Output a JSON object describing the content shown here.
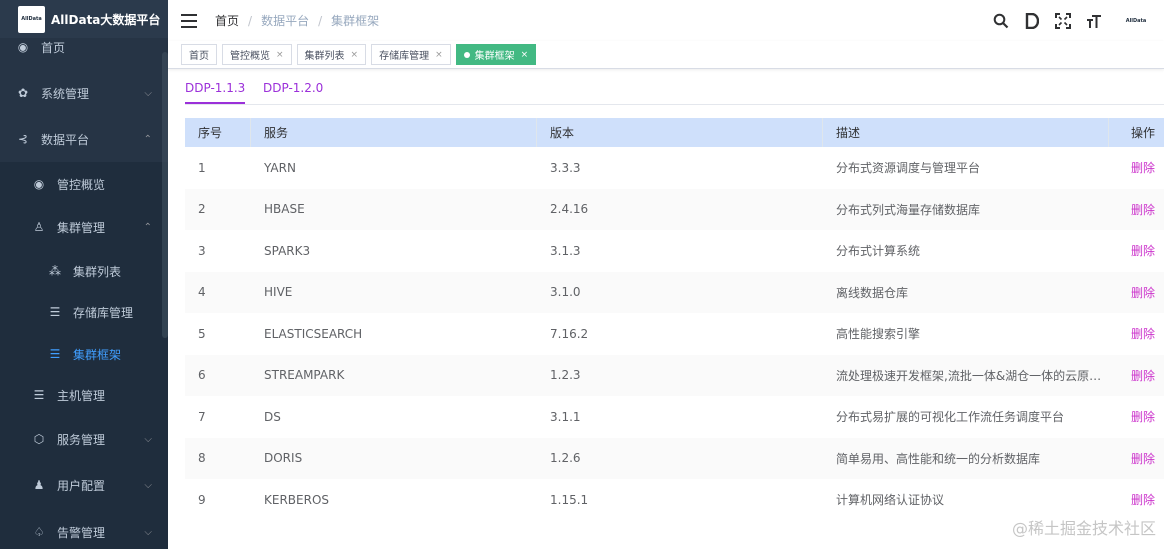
{
  "app": {
    "logo_text": "AllData",
    "title": "AllData大数据平台"
  },
  "sidebar": {
    "items": [
      {
        "label": "首页",
        "icon": "dashboard-icon"
      },
      {
        "label": "系统管理",
        "icon": "gear-icon"
      },
      {
        "label": "数据平台",
        "icon": "share-icon"
      },
      {
        "label": "管控概览",
        "icon": "dashboard-icon"
      },
      {
        "label": "集群管理",
        "icon": "cluster-icon"
      },
      {
        "label": "集群列表",
        "icon": "nodes-icon"
      },
      {
        "label": "存储库管理",
        "icon": "database-icon"
      },
      {
        "label": "集群框架",
        "icon": "database-icon"
      },
      {
        "label": "主机管理",
        "icon": "server-icon"
      },
      {
        "label": "服务管理",
        "icon": "cube-icon"
      },
      {
        "label": "用户配置",
        "icon": "user-icon"
      },
      {
        "label": "告警管理",
        "icon": "bell-icon"
      }
    ]
  },
  "breadcrumb": [
    "首页",
    "数据平台",
    "集群框架"
  ],
  "header": {
    "avatar_text": "AllData",
    "tools": [
      "search-icon",
      "document-icon",
      "fullscreen-icon",
      "font-size-icon"
    ]
  },
  "tags": [
    {
      "label": "首页"
    },
    {
      "label": "管控概览"
    },
    {
      "label": "集群列表"
    },
    {
      "label": "存储库管理"
    },
    {
      "label": "集群框架"
    }
  ],
  "version_tabs": [
    "DDP-1.1.3",
    "DDP-1.2.0"
  ],
  "table": {
    "columns": [
      "序号",
      "服务",
      "版本",
      "描述",
      "操作"
    ],
    "rows": [
      {
        "no": "1",
        "service": "YARN",
        "version": "3.3.3",
        "desc": "分布式资源调度与管理平台",
        "action": "删除"
      },
      {
        "no": "2",
        "service": "HBASE",
        "version": "2.4.16",
        "desc": "分布式列式海量存储数据库",
        "action": "删除"
      },
      {
        "no": "3",
        "service": "SPARK3",
        "version": "3.1.3",
        "desc": "分布式计算系统",
        "action": "删除"
      },
      {
        "no": "4",
        "service": "HIVE",
        "version": "3.1.0",
        "desc": "离线数据仓库",
        "action": "删除"
      },
      {
        "no": "5",
        "service": "ELASTICSEARCH",
        "version": "7.16.2",
        "desc": "高性能搜索引擎",
        "action": "删除"
      },
      {
        "no": "6",
        "service": "STREAMPARK",
        "version": "1.2.3",
        "desc": "流处理极速开发框架,流批一体&湖仓一体的云原…",
        "action": "删除"
      },
      {
        "no": "7",
        "service": "DS",
        "version": "3.1.1",
        "desc": "分布式易扩展的可视化工作流任务调度平台",
        "action": "删除"
      },
      {
        "no": "8",
        "service": "DORIS",
        "version": "1.2.6",
        "desc": "简单易用、高性能和统一的分析数据库",
        "action": "删除"
      },
      {
        "no": "9",
        "service": "KERBEROS",
        "version": "1.15.1",
        "desc": "计算机网络认证协议",
        "action": "删除"
      }
    ]
  },
  "watermark": "@稀土掘金技术社区",
  "colors": {
    "sidebar_bg": "#263445",
    "active_tag": "#42b983",
    "active_menu": "#409eff",
    "accent": "#9b30d9",
    "table_header": "#cfe0fb"
  }
}
